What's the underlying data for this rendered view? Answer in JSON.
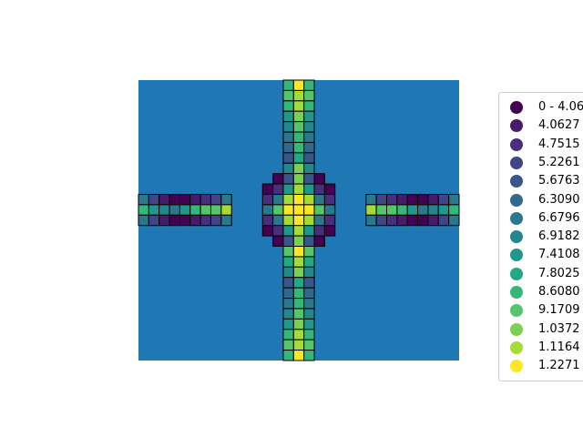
{
  "chart_data": {
    "type": "choropleth",
    "background_color": "#1f77b4",
    "cell_edge_color": "#000000",
    "colormap": "viridis",
    "legend": {
      "placement": "right",
      "entries": [
        {
          "label": "0 - 4.06",
          "color": "#440154"
        },
        {
          "label": "4.0627",
          "color": "#481a6c"
        },
        {
          "label": "4.7515",
          "color": "#472f7d"
        },
        {
          "label": "5.2261",
          "color": "#414487"
        },
        {
          "label": "5.6763",
          "color": "#39568c"
        },
        {
          "label": "6.3090",
          "color": "#31688e"
        },
        {
          "label": "6.6796",
          "color": "#2a788e"
        },
        {
          "label": "6.9182",
          "color": "#23888e"
        },
        {
          "label": "7.4108",
          "color": "#1f988b"
        },
        {
          "label": "7.8025",
          "color": "#22a884"
        },
        {
          "label": "8.6080",
          "color": "#35b779"
        },
        {
          "label": "9.1709",
          "color": "#54c568"
        },
        {
          "label": "1.0372",
          "color": "#7ad151"
        },
        {
          "label": "1.1164",
          "color": "#a5db36"
        },
        {
          "label": "1.2271",
          "color": "#fde725"
        }
      ]
    },
    "vertical_arm": [
      [
        10,
        14,
        10
      ],
      [
        11,
        13,
        11
      ],
      [
        10,
        13,
        10
      ],
      [
        8,
        12,
        8
      ],
      [
        7,
        11,
        7
      ],
      [
        6,
        10,
        6
      ],
      [
        5,
        10,
        5
      ],
      [
        4,
        9,
        4
      ],
      [
        7,
        12,
        7
      ],
      [
        9,
        13,
        9
      ],
      [
        11,
        14,
        11
      ]
    ],
    "center_block": [
      [
        null,
        0,
        4,
        12,
        4,
        0,
        null
      ],
      [
        0,
        2,
        8,
        13,
        8,
        2,
        0
      ],
      [
        2,
        6,
        13,
        14,
        13,
        6,
        2
      ],
      [
        6,
        11,
        14,
        14,
        14,
        11,
        6
      ],
      [
        2,
        6,
        13,
        14,
        13,
        6,
        2
      ],
      [
        0,
        2,
        8,
        13,
        8,
        2,
        0
      ],
      [
        null,
        0,
        4,
        12,
        4,
        0,
        null
      ]
    ],
    "horizontal_arm": [
      [
        6,
        10,
        6
      ],
      [
        3,
        8,
        3
      ],
      [
        1,
        7,
        1
      ],
      [
        0,
        6,
        0
      ],
      [
        0,
        8,
        0
      ],
      [
        1,
        10,
        1
      ],
      [
        2,
        11,
        2
      ],
      [
        3,
        11,
        3
      ],
      [
        6,
        13,
        6
      ]
    ]
  }
}
